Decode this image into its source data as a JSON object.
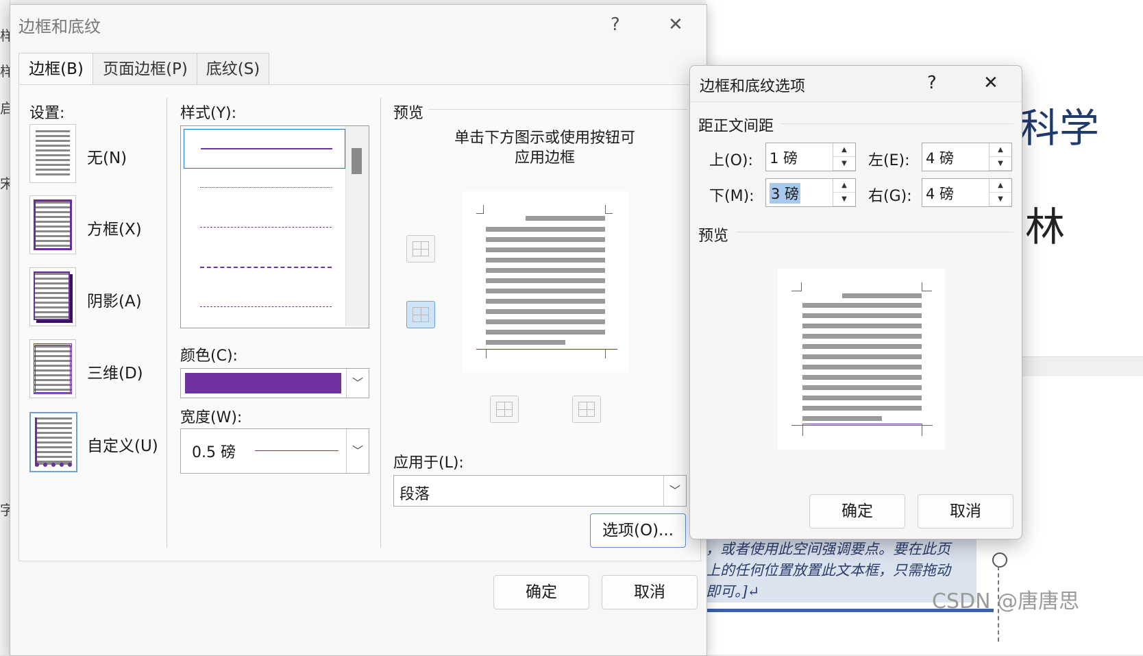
{
  "main_dialog": {
    "title": "边框和底纹",
    "help": "?",
    "close": "✕",
    "tabs": [
      "边框(B)",
      "页面边框(P)",
      "底纹(S)"
    ],
    "settings_label": "设置:",
    "settings": [
      "无(N)",
      "方框(X)",
      "阴影(A)",
      "三维(D)",
      "自定义(U)"
    ],
    "style_label": "样式(Y):",
    "color_label": "颜色(C):",
    "color_value": "#7030a0",
    "width_label": "宽度(W):",
    "width_value": "0.5 磅",
    "preview_label": "预览",
    "preview_hint_1": "单击下方图示或使用按钮可",
    "preview_hint_2": "应用边框",
    "apply_label": "应用于(L):",
    "apply_value": "段落",
    "options_button": "选项(O)...",
    "ok": "确定",
    "cancel": "取消"
  },
  "options_dialog": {
    "title": "边框和底纹选项",
    "help": "?",
    "close": "✕",
    "section": "距正文间距",
    "top_label": "上(O):",
    "top_value": "1 磅",
    "bottom_label": "下(M):",
    "bottom_value": "3 磅",
    "left_label": "左(E):",
    "left_value": "4 磅",
    "right_label": "右(G):",
    "right_value": "4 磅",
    "preview_label": "预览",
    "ok": "确定",
    "cancel": "取消"
  },
  "background": {
    "text_big_1": "科学",
    "text_big_2": "林",
    "para_line_1": "，或者使用此空间强调要点。要在此页",
    "para_line_2": "上的任何位置放置此文本框，只需拖动",
    "para_line_3": "即可。]↵",
    "watermark": "CSDN @唐唐思",
    "left_chars": [
      "样",
      "样",
      "启",
      "宋",
      "字"
    ]
  }
}
